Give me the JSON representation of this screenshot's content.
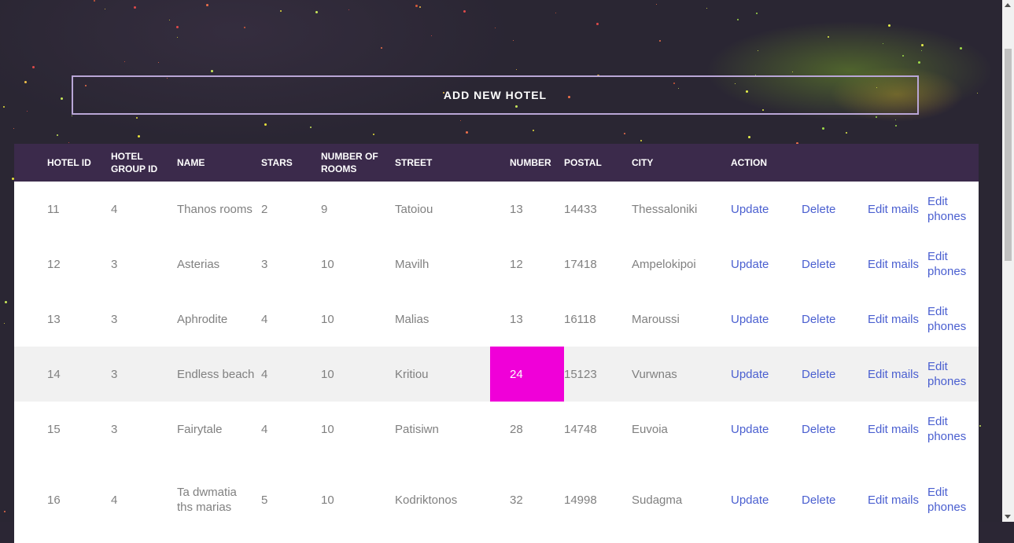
{
  "add_button_label": "ADD NEW HOTEL",
  "table": {
    "headers": [
      "HOTEL ID",
      "HOTEL GROUP ID",
      "NAME",
      "STARS",
      "NUMBER OF ROOMS",
      "STREET",
      "NUMBER",
      "POSTAL",
      "CITY",
      "ACTION"
    ],
    "action_labels": {
      "update": "Update",
      "delete": "Delete",
      "edit_mails": "Edit mails",
      "edit_phones": "Edit phones"
    },
    "rows": [
      {
        "hotel_id": "11",
        "group_id": "4",
        "name": "Thanos rooms",
        "stars": "2",
        "rooms": "9",
        "street": "Tatoiou",
        "number": "13",
        "postal": "14433",
        "city": "Thessaloniki"
      },
      {
        "hotel_id": "12",
        "group_id": "3",
        "name": "Asterias",
        "stars": "3",
        "rooms": "10",
        "street": "Mavilh",
        "number": "12",
        "postal": "17418",
        "city": "Ampelokipoi"
      },
      {
        "hotel_id": "13",
        "group_id": "3",
        "name": "Aphrodite",
        "stars": "4",
        "rooms": "10",
        "street": "Malias",
        "number": "13",
        "postal": "16118",
        "city": "Maroussi"
      },
      {
        "hotel_id": "14",
        "group_id": "3",
        "name": "Endless beach",
        "stars": "4",
        "rooms": "10",
        "street": "Kritiou",
        "number": "24",
        "postal": "15123",
        "city": "Vurwnas"
      },
      {
        "hotel_id": "15",
        "group_id": "3",
        "name": "Fairytale",
        "stars": "4",
        "rooms": "10",
        "street": "Patisiwn",
        "number": "28",
        "postal": "14748",
        "city": "Euvoia"
      },
      {
        "hotel_id": "16",
        "group_id": "4",
        "name": "Ta dwmatia ths marias",
        "stars": "5",
        "rooms": "10",
        "street": "Kodriktonos",
        "number": "32",
        "postal": "14998",
        "city": "Sudagma"
      }
    ]
  },
  "colors": {
    "header_bg": "#3b2a4b",
    "link": "#4a5fd0",
    "highlight_cell": "#f000d8",
    "button_border": "#b9a6d6"
  }
}
